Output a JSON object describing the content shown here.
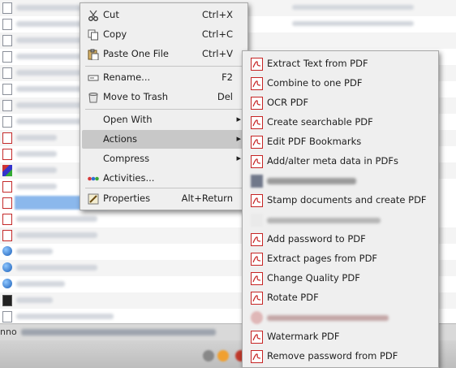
{
  "status_bar": {
    "text": "nno"
  },
  "context_menu": {
    "items": [
      {
        "label": "Cut",
        "shortcut": "Ctrl+X",
        "icon": "scissors-icon"
      },
      {
        "label": "Copy",
        "shortcut": "Ctrl+C",
        "icon": "copy-icon"
      },
      {
        "label": "Paste One File",
        "shortcut": "Ctrl+V",
        "icon": "paste-icon"
      },
      {
        "label": "Rename...",
        "shortcut": "F2",
        "icon": "rename-icon"
      },
      {
        "label": "Move to Trash",
        "shortcut": "Del",
        "icon": "trash-icon"
      },
      {
        "label": "Open With",
        "shortcut": "",
        "icon": ""
      },
      {
        "label": "Actions",
        "shortcut": "",
        "icon": ""
      },
      {
        "label": "Compress",
        "shortcut": "",
        "icon": ""
      },
      {
        "label": "Activities...",
        "shortcut": "",
        "icon": "activities-icon"
      },
      {
        "label": "Properties",
        "shortcut": "Alt+Return",
        "icon": "properties-icon"
      }
    ],
    "highlighted": "Actions"
  },
  "actions_submenu": {
    "items": [
      {
        "label": "Extract Text from PDF",
        "enabled": true
      },
      {
        "label": "Combine to one PDF",
        "enabled": true
      },
      {
        "label": "OCR PDF",
        "enabled": true
      },
      {
        "label": "Create searchable PDF",
        "enabled": true
      },
      {
        "label": "Edit PDF Bookmarks",
        "enabled": true
      },
      {
        "label": "Add/alter meta data in PDFs",
        "enabled": true
      },
      {
        "label": "",
        "enabled": false
      },
      {
        "label": "Stamp documents and create PDF",
        "enabled": true
      },
      {
        "label": "",
        "enabled": false
      },
      {
        "label": "Add password to PDF",
        "enabled": true
      },
      {
        "label": "Extract pages from PDF",
        "enabled": true
      },
      {
        "label": "Change Quality PDF",
        "enabled": true
      },
      {
        "label": "Rotate PDF",
        "enabled": true
      },
      {
        "label": "",
        "enabled": false
      },
      {
        "label": "Watermark PDF",
        "enabled": true
      },
      {
        "label": "Remove password from PDF",
        "enabled": true
      }
    ]
  },
  "colors": {
    "menu_bg": "#efefef",
    "highlight": "#c8c8c8",
    "pdf_red": "#c62424",
    "selection": "#8bb8ec"
  }
}
